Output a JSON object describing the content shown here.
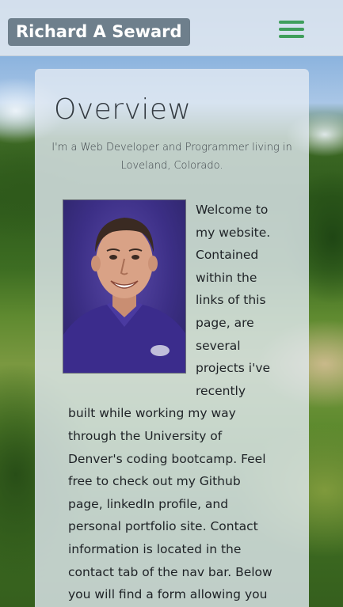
{
  "header": {
    "brand": "Richard A Seward",
    "menu_icon": "hamburger-menu-icon",
    "menu_color": "#3f9e5b"
  },
  "overview": {
    "title": "Overview",
    "subtitle": "I'm a Web Developer and Programmer living in Loveland, Colorado.",
    "photo_icon": "profile-photo",
    "body": "Welcome to my website. Contained within the links of this page, are several projects i've recently built while working my way through the University of Denver's coding bootcamp. Feel free to check out my Github page, linkedIn profile, and personal portfolio site. Contact information is located in the contact tab of the nav bar. Below you will find a form allowing you to submit your contact"
  }
}
